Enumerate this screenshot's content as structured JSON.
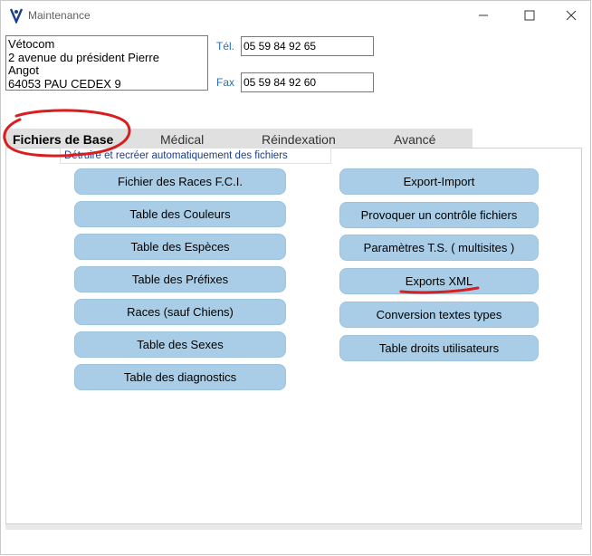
{
  "window": {
    "title": "Maintenance",
    "icon": "app-logo-icon",
    "controls": [
      "minimize-icon",
      "maximize-icon",
      "close-icon"
    ]
  },
  "address": {
    "lines": [
      "Vétocom",
      "2 avenue du président Pierre",
      "Angot",
      "64053 PAU CEDEX 9"
    ]
  },
  "contact": {
    "tel_label": "Tél.",
    "tel_value": "05 59 84 92 65",
    "fax_label": "Fax",
    "fax_value": "05 59 84 92 60"
  },
  "tabs": [
    {
      "label": "Fichiers de Base",
      "active": true
    },
    {
      "label": "Médical",
      "active": false
    },
    {
      "label": "Réindexation",
      "active": false
    },
    {
      "label": "Avancé",
      "active": false
    }
  ],
  "panel": {
    "subtitle": "Détruire et recréer automatiquement  des fichiers"
  },
  "left_buttons": [
    "Fichier des  Races F.C.I.",
    "Table des Couleurs",
    "Table des Espèces",
    "Table des Préfixes",
    "Races (sauf Chiens)",
    "Table des Sexes",
    "Table des diagnostics"
  ],
  "right_buttons": [
    "Export-Import",
    "Provoquer un contrôle fichiers",
    "Paramètres T.S. ( multisites )",
    "Exports XML",
    "Conversion textes types",
    "Table droits utilisateurs"
  ],
  "colors": {
    "button_bg": "#a9cde6",
    "annotation": "#d81e1e",
    "label_blue": "#2a6fb0"
  }
}
